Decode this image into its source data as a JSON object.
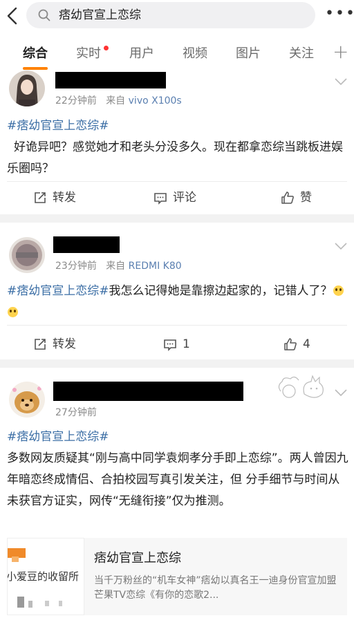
{
  "search": {
    "query": "痞幼官宣上恋综"
  },
  "tabs": [
    {
      "label": "综合"
    },
    {
      "label": "实时"
    },
    {
      "label": "用户"
    },
    {
      "label": "视频"
    },
    {
      "label": "图片"
    },
    {
      "label": "关注"
    }
  ],
  "icons": {
    "back": "chevron-left-icon",
    "search": "search-icon",
    "more": "more-dots-icon",
    "plus": "plus-icon"
  },
  "colors": {
    "accent": "#ff8200",
    "tag": "#3b6ea5",
    "source": "#5a7fb0",
    "notify": "#ff3333"
  },
  "posts": [
    {
      "time": "22分钟前",
      "source_prefix": "来自",
      "source": "vivo X100s",
      "tag": "#痞幼官宣上恋综#",
      "text": "好诡异吧？感觉她才和老头分没多久。现在都拿恋综当跳板进娱乐圈吗？",
      "actions": {
        "repost": "转发",
        "comment": "评论",
        "like": "赞"
      }
    },
    {
      "time": "23分钟前",
      "source_prefix": "来自",
      "source": "REDMI K80",
      "tag": "#痞幼官宣上恋综#",
      "text": "我怎么记得她是靠擦边起家的，记错人了？",
      "actions": {
        "repost": "转发",
        "comment": "1",
        "like": "4"
      }
    },
    {
      "time": "27分钟前",
      "tag": "#痞幼官宣上恋综#",
      "text": "多数网友质疑其“刚与高中同学袁炯孝分手即上恋综”。两人曾因九年暗恋终成情侣、合拍校园写真引发关注，但 分手细节与时间从未获官方证实，网传“无缝衔接”仅为推测。",
      "link_card": {
        "thumb_text": "小爱豆的收留所",
        "title": "痞幼官宣上恋综",
        "desc": "当千万粉丝的“机车女神”痞幼以真名王一迪身份官宣加盟芒果TV恋综《有你的恋歌2..."
      }
    }
  ]
}
